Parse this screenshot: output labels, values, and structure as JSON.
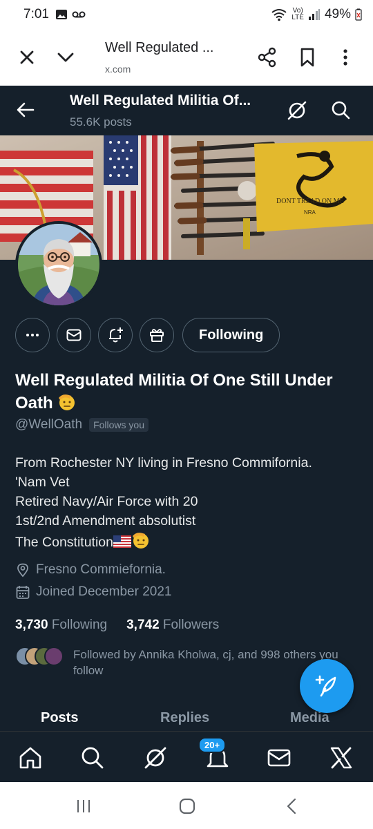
{
  "status_bar": {
    "time": "7:01",
    "network_top": "Vo)",
    "network_bottom": "LTE",
    "battery": "49%"
  },
  "browser": {
    "page_title": "Well Regulated ...",
    "url": "x.com"
  },
  "profile_header": {
    "title": "Well Regulated Militia Of...",
    "posts_count": "55.6K posts"
  },
  "actions": {
    "following_label": "Following"
  },
  "profile": {
    "display_name": "Well Regulated Militia Of One Still Under Oath",
    "handle": "@WellOath",
    "follows_you": "Follows you",
    "bio_lines": [
      "From Rochester NY living in Fresno Commifornia.",
      "'Nam Vet",
      "Retired Navy/Air Force with 20",
      "1st/2nd Amendment absolutist",
      "The Constitution"
    ],
    "location": "Fresno Commiefornia.",
    "joined": "Joined December 2021",
    "following_count": "3,730",
    "following_label": "Following",
    "followers_count": "3,742",
    "followers_label": "Followers",
    "followed_by": "Followed by Annika Kholwa, cj, and 998 others you follow"
  },
  "tabs": [
    "Posts",
    "Replies",
    "Media"
  ],
  "bottom_nav": {
    "notification_badge": "20+"
  },
  "colors": {
    "background": "#15202b",
    "accent": "#1d9bf0",
    "muted_text": "#8b98a5"
  },
  "icons": [
    "close-icon",
    "chevron-down-icon",
    "share-icon",
    "bookmark-icon",
    "more-vertical-icon",
    "back-arrow-icon",
    "grok-icon",
    "search-icon",
    "more-horizontal-icon",
    "mail-icon",
    "notification-add-icon",
    "gift-icon",
    "salute-emoji",
    "us-flag-emoji",
    "location-icon",
    "calendar-icon",
    "compose-icon",
    "home-icon",
    "bell-icon",
    "x-logo-icon"
  ]
}
